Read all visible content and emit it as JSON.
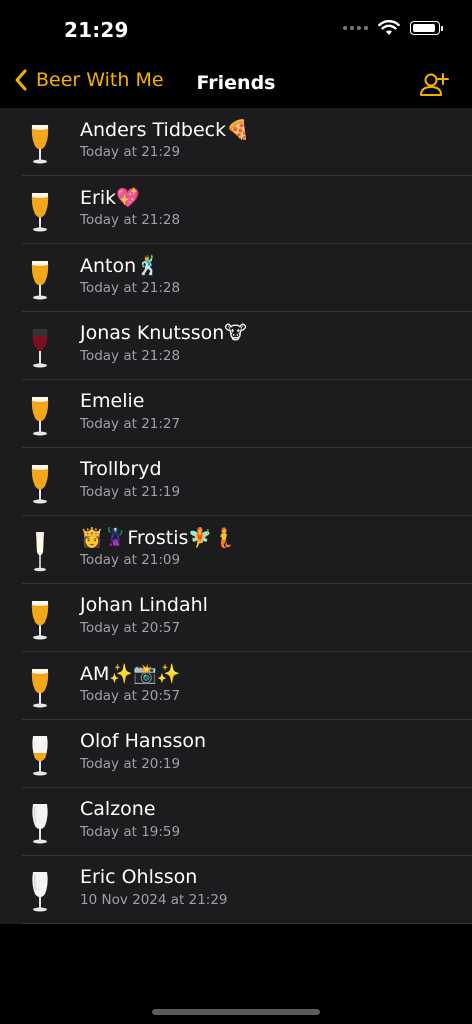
{
  "status_bar": {
    "time": "21:29",
    "battery_level": 0.95
  },
  "nav": {
    "back_label": "Beer With Me",
    "title": "Friends",
    "add_icon": "add-friend-icon",
    "accent_color": "#F5B100"
  },
  "friends": [
    {
      "name": "Anders Tidbeck🍕",
      "time": "Today at 21:29",
      "drink": "beer"
    },
    {
      "name": "Erik💖",
      "time": "Today at 21:28",
      "drink": "beer"
    },
    {
      "name": "Anton🕺",
      "time": "Today at 21:28",
      "drink": "beer"
    },
    {
      "name": "Jonas Knutsson🐮",
      "time": "Today at 21:28",
      "drink": "red-wine"
    },
    {
      "name": "Emelie",
      "time": "Today at 21:27",
      "drink": "beer"
    },
    {
      "name": "Trollbryd",
      "time": "Today at 21:19",
      "drink": "beer"
    },
    {
      "name": "👸🦹Frostis🧚🧜",
      "time": "Today at 21:09",
      "drink": "champagne"
    },
    {
      "name": "Johan Lindahl",
      "time": "Today at 20:57",
      "drink": "beer"
    },
    {
      "name": "AM✨📸✨",
      "time": "Today at 20:57",
      "drink": "beer"
    },
    {
      "name": "Olof Hansson",
      "time": "Today at 20:19",
      "drink": "white-beer"
    },
    {
      "name": "Calzone",
      "time": "Today at 19:59",
      "drink": "empty-glass"
    },
    {
      "name": "Eric Ohlsson",
      "time": "10 Nov 2024 at 21:29",
      "drink": "empty-glass"
    }
  ]
}
